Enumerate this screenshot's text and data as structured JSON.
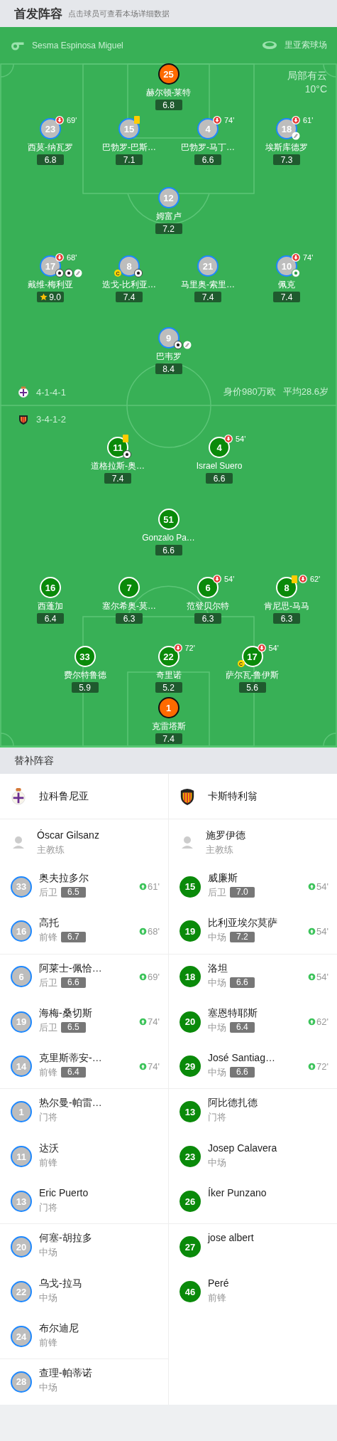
{
  "header": {
    "title": "首发阵容",
    "hint": "点击球员可查看本场详细数据"
  },
  "pitch": {
    "referee": "Sesma Espinosa Miguel",
    "stadium": "里亚索球场",
    "weather": "局部有云",
    "temperature": "10°C",
    "home": {
      "formation": "4-1-4-1",
      "market_value": "身价980万欧",
      "avg_age": "平均28.6岁",
      "rows": [
        [
          {
            "number": "25",
            "name": "赫尔顿-莱特",
            "rating": "6.8",
            "kind": "goalkeeper",
            "yellow_card": false,
            "mvp": false
          }
        ],
        [
          {
            "number": "23",
            "name": "西莫-纳瓦罗",
            "rating": "6.8",
            "kind": "outfield",
            "yellow_card": false,
            "mvp": false,
            "sub_off": "69'"
          },
          {
            "number": "15",
            "name": "巴勃罗-巴斯…",
            "rating": "7.1",
            "kind": "outfield",
            "yellow_card": true,
            "mvp": false
          },
          {
            "number": "4",
            "name": "巴勃罗-马丁…",
            "rating": "6.6",
            "kind": "outfield",
            "yellow_card": false,
            "mvp": false,
            "sub_off": "74'"
          },
          {
            "number": "18",
            "name": "埃斯库德罗",
            "rating": "7.3",
            "kind": "outfield",
            "yellow_card": false,
            "mvp": false,
            "sub_off": "61'",
            "events": [
              {
                "kind": "assist"
              }
            ]
          }
        ],
        [
          {
            "number": "12",
            "name": "姆富卢",
            "rating": "7.2",
            "kind": "outfield",
            "yellow_card": false,
            "mvp": false
          }
        ],
        [
          {
            "number": "17",
            "name": "戴维-梅利亚",
            "rating": "9.0",
            "kind": "outfield",
            "yellow_card": false,
            "mvp": true,
            "sub_off": "68'",
            "events": [
              {
                "kind": "goal"
              },
              {
                "kind": "goal"
              },
              {
                "kind": "assist"
              }
            ]
          },
          {
            "number": "8",
            "name": "迭戈-比利亚…",
            "rating": "7.4",
            "kind": "outfield",
            "yellow_card": false,
            "mvp": false,
            "captain_badge": "C",
            "events": [
              {
                "kind": "goal"
              }
            ]
          },
          {
            "number": "21",
            "name": "马里奥-索里…",
            "rating": "7.4",
            "kind": "outfield",
            "yellow_card": false,
            "mvp": false
          },
          {
            "number": "10",
            "name": "佩克",
            "rating": "7.4",
            "kind": "outfield",
            "yellow_card": false,
            "mvp": false,
            "sub_off": "74'",
            "events": [
              {
                "kind": "green_ball"
              }
            ]
          }
        ],
        [
          {
            "number": "9",
            "name": "巴韦罗",
            "rating": "8.4",
            "kind": "outfield",
            "yellow_card": false,
            "mvp": false,
            "events": [
              {
                "kind": "goal"
              },
              {
                "kind": "assist"
              }
            ]
          }
        ]
      ]
    },
    "away": {
      "formation": "3-4-1-2",
      "rows": [
        [
          {
            "number": "11",
            "name": "道格拉斯-奥…",
            "rating": "7.4",
            "kind": "outfield",
            "yellow_card": true,
            "mvp": false,
            "events": [
              {
                "kind": "goal"
              }
            ]
          },
          {
            "number": "4",
            "name": "Israel Suero",
            "rating": "6.6",
            "kind": "outfield",
            "yellow_card": false,
            "mvp": false,
            "sub_off": "54'"
          }
        ],
        [
          {
            "number": "51",
            "name": "Gonzalo Pa…",
            "rating": "6.6",
            "kind": "outfield",
            "yellow_card": false,
            "mvp": false
          }
        ],
        [
          {
            "number": "16",
            "name": "西蓬加",
            "rating": "6.4",
            "kind": "outfield",
            "yellow_card": false,
            "mvp": false
          },
          {
            "number": "7",
            "name": "塞尔希奥-莫…",
            "rating": "6.3",
            "kind": "outfield",
            "yellow_card": false,
            "mvp": false
          },
          {
            "number": "6",
            "name": "范登贝尔特",
            "rating": "6.3",
            "kind": "outfield",
            "yellow_card": false,
            "mvp": false,
            "sub_off": "54'"
          },
          {
            "number": "8",
            "name": "肯尼思-马马",
            "rating": "6.3",
            "kind": "outfield",
            "yellow_card": true,
            "mvp": false,
            "sub_off": "62'"
          }
        ],
        [
          {
            "number": "33",
            "name": "费尔特鲁德",
            "rating": "5.9",
            "kind": "outfield",
            "yellow_card": false,
            "mvp": false
          },
          {
            "number": "22",
            "name": "奇里诺",
            "rating": "5.2",
            "kind": "outfield",
            "yellow_card": false,
            "mvp": false,
            "sub_off": "72'"
          },
          {
            "number": "17",
            "name": "萨尔瓦-鲁伊斯",
            "rating": "5.6",
            "kind": "outfield",
            "yellow_card": false,
            "mvp": false,
            "sub_off": "54'",
            "captain_badge": "C"
          }
        ],
        [
          {
            "number": "1",
            "name": "克雷塔斯",
            "rating": "7.4",
            "kind": "goalkeeper",
            "yellow_card": false,
            "mvp": false
          }
        ]
      ]
    }
  },
  "substitutes": {
    "title": "替补阵容",
    "teams": [
      {
        "name": "拉科鲁尼亚",
        "coach": "Óscar Gilsanz",
        "coach_role": "主教练",
        "players": [
          {
            "number": "33",
            "name": "奥夫拉多尔",
            "position": "后卫",
            "rating": "6.5",
            "sub_on": "61'"
          },
          {
            "number": "16",
            "name": "高托",
            "position": "前锋",
            "rating": "6.7",
            "sub_on": "68'"
          },
          {
            "number": "6",
            "name": "阿莱士-佩恰…",
            "position": "后卫",
            "rating": "6.6",
            "sub_on": "69'"
          },
          {
            "number": "19",
            "name": "海梅-桑切斯",
            "position": "后卫",
            "rating": "6.5",
            "sub_on": "74'"
          },
          {
            "number": "14",
            "name": "克里斯蒂安-…",
            "position": "前锋",
            "rating": "6.4",
            "sub_on": "74'"
          },
          {
            "number": "1",
            "name": "热尔曼-帕雷…",
            "position": "门将"
          },
          {
            "number": "11",
            "name": "达沃",
            "position": "前锋"
          },
          {
            "number": "13",
            "name": "Eric Puerto",
            "position": "门将"
          },
          {
            "number": "20",
            "name": "何塞-胡拉多",
            "position": "中场"
          },
          {
            "number": "22",
            "name": "乌戈-拉马",
            "position": "中场"
          },
          {
            "number": "24",
            "name": "布尔迪尼",
            "position": "前锋"
          },
          {
            "number": "28",
            "name": "查理-帕蒂诺",
            "position": "中场"
          }
        ]
      },
      {
        "name": "卡斯特利翁",
        "coach": "施罗伊德",
        "coach_role": "主教练",
        "players": [
          {
            "number": "15",
            "name": "威廉斯",
            "position": "后卫",
            "rating": "7.0",
            "sub_on": "54'"
          },
          {
            "number": "19",
            "name": "比利亚埃尔莫萨",
            "position": "中场",
            "rating": "7.2",
            "sub_on": "54'"
          },
          {
            "number": "18",
            "name": "洛坦",
            "position": "中场",
            "rating": "6.6",
            "sub_on": "54'"
          },
          {
            "number": "20",
            "name": "塞恩特耶斯",
            "position": "中场",
            "rating": "6.4",
            "sub_on": "62'"
          },
          {
            "number": "29",
            "name": "José Santiag…",
            "position": "中场",
            "rating": "6.6",
            "sub_on": "72'"
          },
          {
            "number": "13",
            "name": "阿比德扎德",
            "position": "门将"
          },
          {
            "number": "23",
            "name": "Josep Calavera",
            "position": "中场"
          },
          {
            "number": "26",
            "name": "Íker Punzano"
          },
          {
            "number": "27",
            "name": "jose albert"
          },
          {
            "number": "46",
            "name": "Peré",
            "position": "前锋"
          }
        ]
      }
    ]
  }
}
